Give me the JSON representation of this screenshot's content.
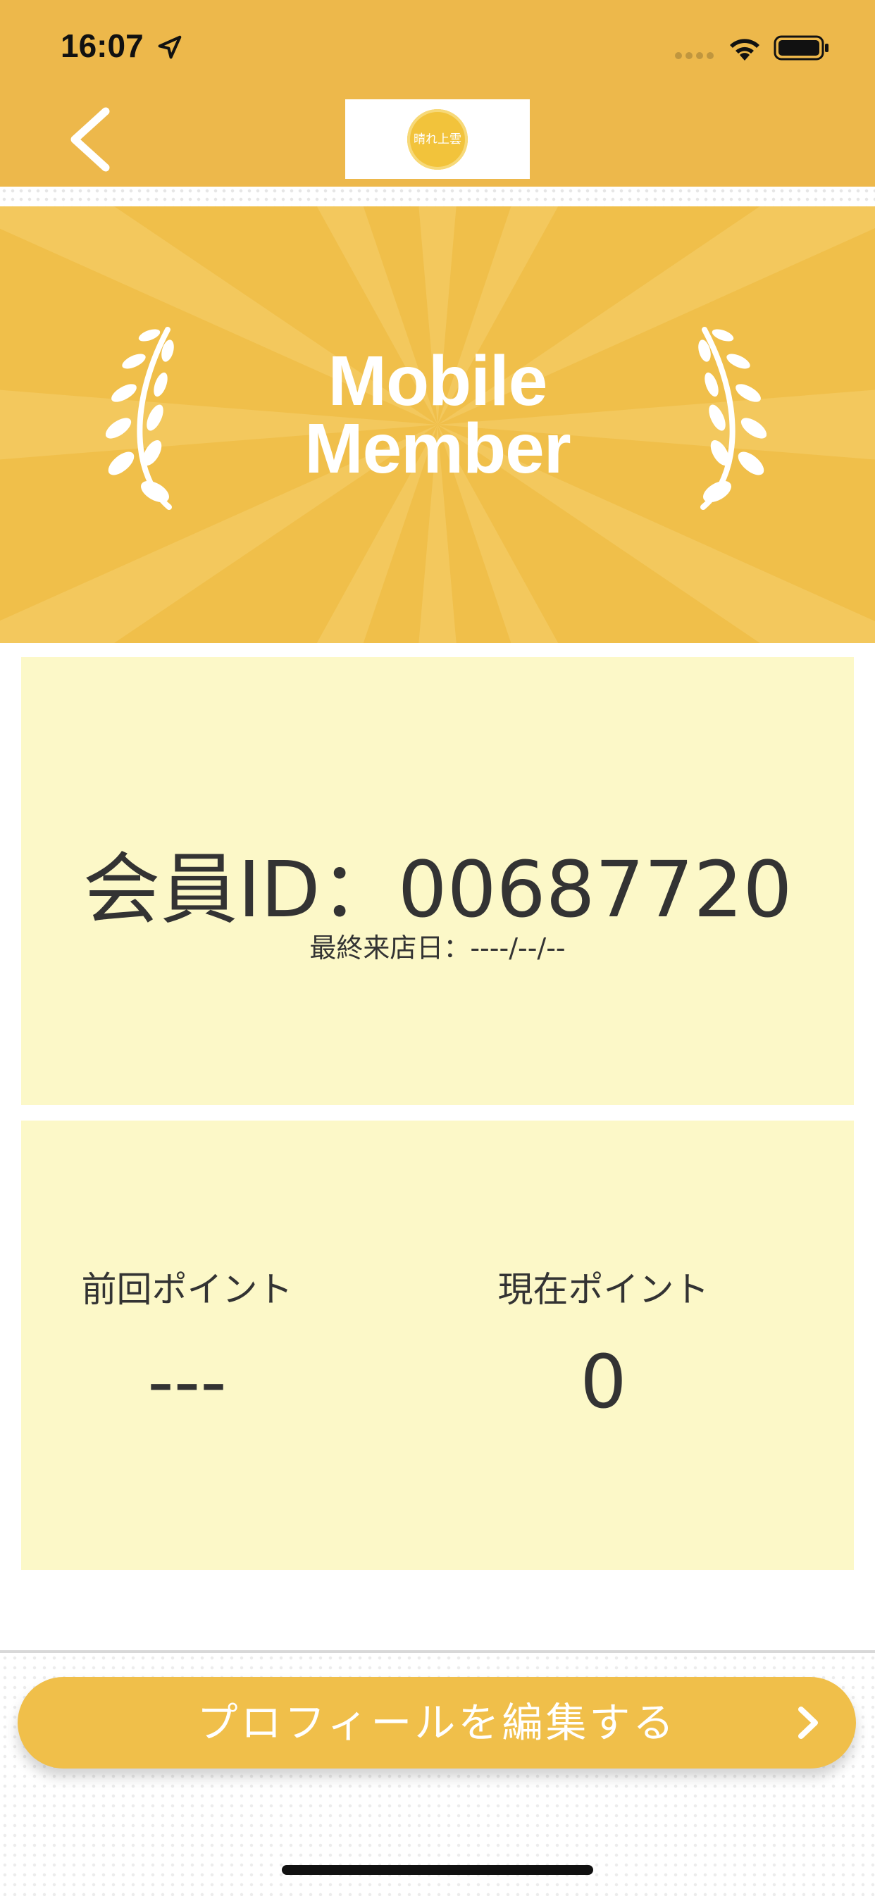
{
  "status_bar": {
    "time": "16:07"
  },
  "nav": {
    "logo_text": "晴れ上雲"
  },
  "hero": {
    "line1": "Mobile",
    "line2": "Member"
  },
  "member": {
    "id_label": "会員ID：00687720",
    "last_visit": "最終来店日：----/--/--"
  },
  "points": {
    "previous_label": "前回ポイント",
    "previous_value": "---",
    "current_label": "現在ポイント",
    "current_value": "0"
  },
  "actions": {
    "edit_profile": "プロフィールを編集する"
  },
  "colors": {
    "brand": "#edb84b",
    "card": "#fcf8c8",
    "button": "#f0bf4a"
  }
}
